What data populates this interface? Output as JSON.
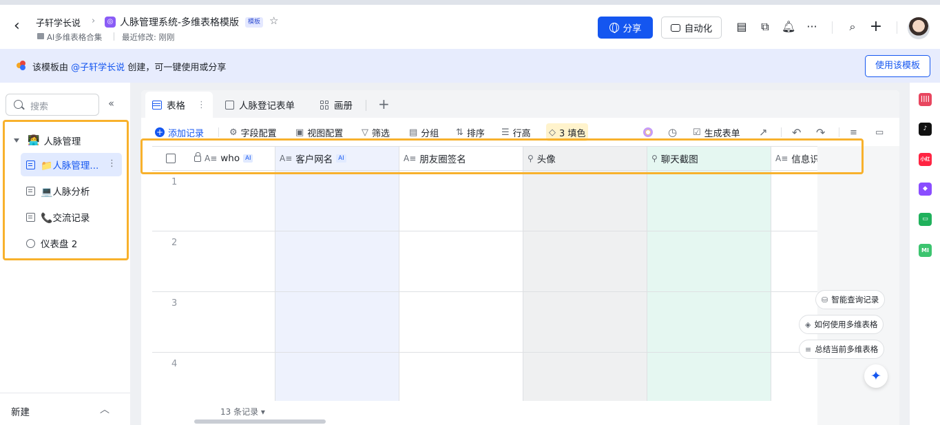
{
  "header": {
    "back_label": "‹",
    "breadcrumb_root": "子轩学长说",
    "breadcrumb_sep": "›",
    "title": "人脉管理系统-多维表格模版",
    "badge": "模板",
    "location": "AI多维表格合集",
    "last_modified": "最近修改: 刚刚",
    "share_label": "分享",
    "automation_label": "自动化"
  },
  "banner": {
    "prefix": "该模板由",
    "mention": "@子轩学长说",
    "suffix": "创建，可一键使用或分享",
    "use_template_label": "使用该模板"
  },
  "sidebar": {
    "search_placeholder": "搜索",
    "root": {
      "emoji": "👩‍💻",
      "label": "人脉管理"
    },
    "items": [
      {
        "emoji": "📁",
        "label": "人脉管理...",
        "active": true
      },
      {
        "emoji": "💻",
        "label": "人脉分析",
        "active": false
      },
      {
        "emoji": "📞",
        "label": "交流记录",
        "active": false
      }
    ],
    "dashboard_label": "仪表盘 2",
    "new_label": "新建"
  },
  "tabs": [
    {
      "label": "表格",
      "active": true
    },
    {
      "label": "人脉登记表单",
      "active": false
    },
    {
      "label": "画册",
      "active": false
    }
  ],
  "toolbar": {
    "add_record": "添加记录",
    "field_config": "字段配置",
    "view_config": "视图配置",
    "filter": "筛选",
    "group": "分组",
    "sort": "排序",
    "row_height": "行高",
    "fill_color": "3 填色",
    "generate_form": "生成表单"
  },
  "columns": [
    {
      "label": "who",
      "ai": "AI",
      "icon": "text-field-icon",
      "bg": "#ffffff"
    },
    {
      "label": "客户网名",
      "ai": "AI",
      "icon": "text-field-icon",
      "bg": "#eef2fd"
    },
    {
      "label": "朋友圈签名",
      "ai": "",
      "icon": "text-field-icon",
      "bg": "#ffffff"
    },
    {
      "label": "头像",
      "ai": "",
      "icon": "attachment-icon",
      "bg": "#eff0f1"
    },
    {
      "label": "聊天截图",
      "ai": "",
      "icon": "attachment-icon",
      "bg": "#e5f7f1"
    },
    {
      "label": "信息识",
      "ai": "",
      "icon": "text-field-icon",
      "bg": "#ffffff"
    }
  ],
  "rows": [
    "1",
    "2",
    "3",
    "4"
  ],
  "footer": {
    "records": "13 条记录"
  },
  "helpers": {
    "smart_query": "智能查询记录",
    "how_to_use": "如何使用多维表格",
    "summarize": "总结当前多维表格"
  },
  "colors": {
    "accent": "#1456f0",
    "highlight_frame": "#f8b12c"
  }
}
